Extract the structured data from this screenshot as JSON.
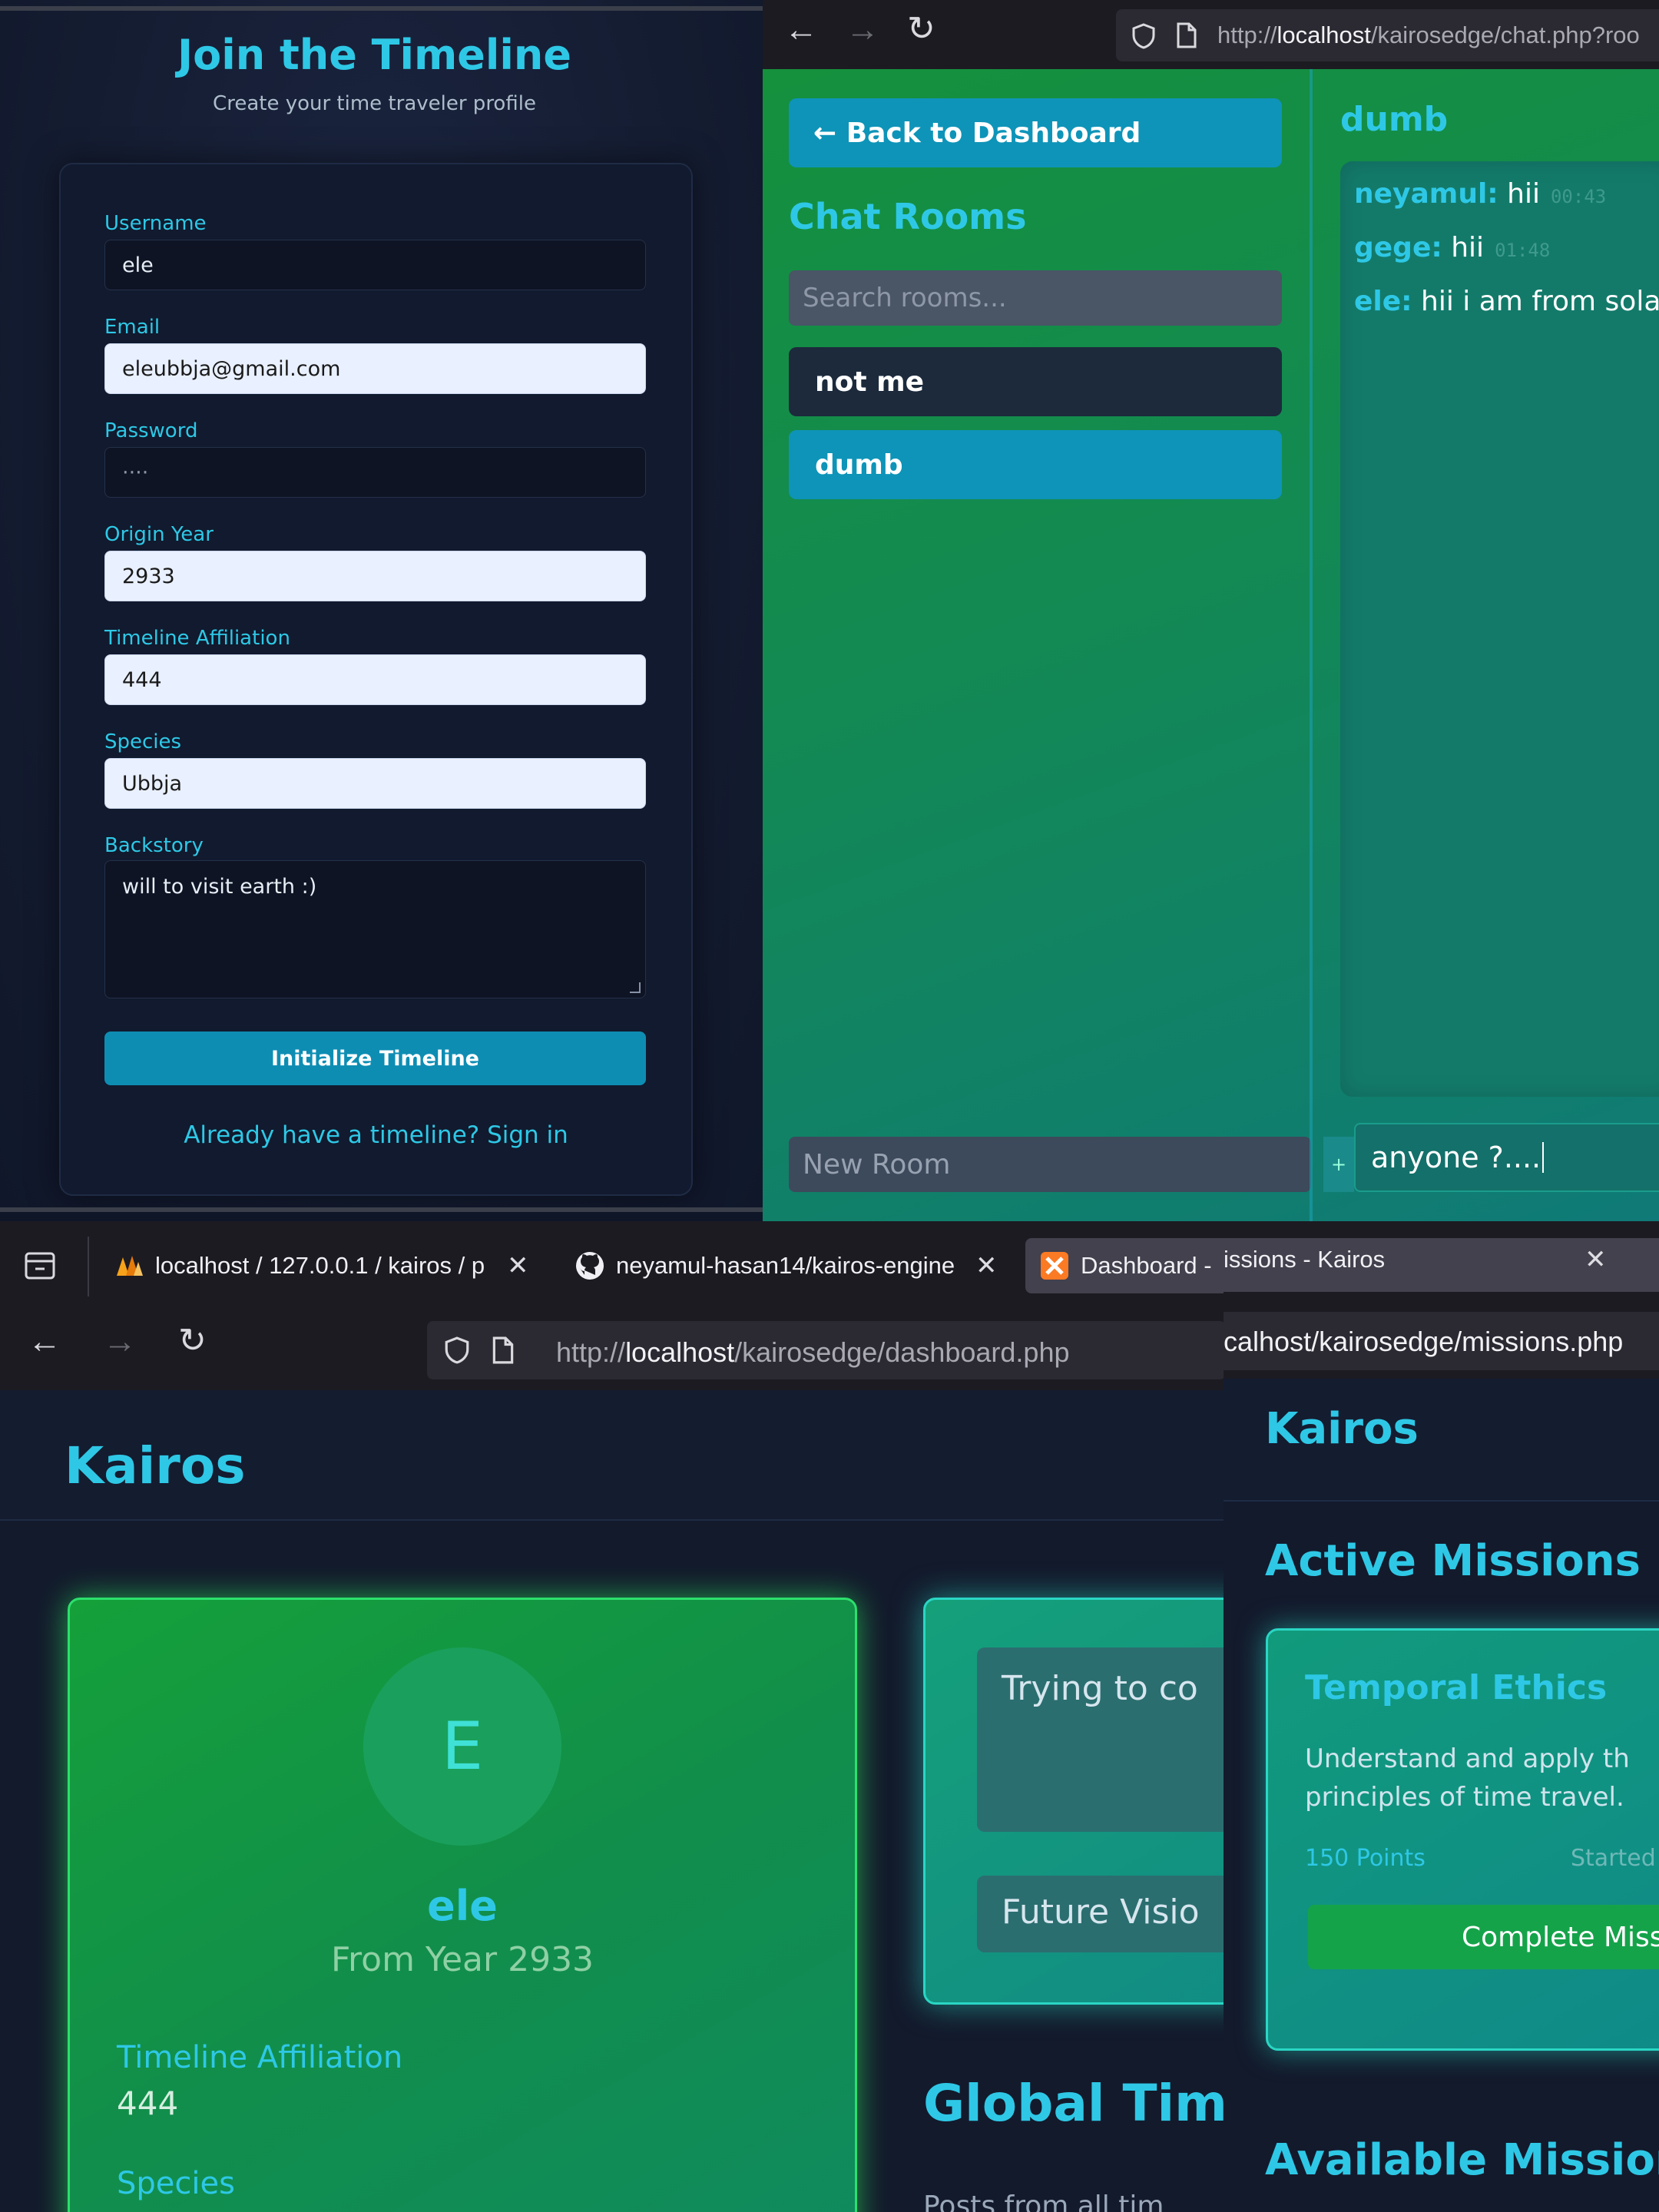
{
  "register": {
    "title": "Join the Timeline",
    "subtitle": "Create your time traveler profile",
    "fields": {
      "username": {
        "label": "Username",
        "value": "ele"
      },
      "email": {
        "label": "Email",
        "value": "eleubbja@gmail.com"
      },
      "password": {
        "label": "Password",
        "value": "····"
      },
      "origin_year": {
        "label": "Origin Year",
        "value": "2933"
      },
      "affiliation": {
        "label": "Timeline Affiliation",
        "value": "444"
      },
      "species": {
        "label": "Species",
        "value": "Ubbja"
      },
      "backstory": {
        "label": "Backstory",
        "value": "will to visit earth :)"
      }
    },
    "submit_label": "Initialize Timeline",
    "signin_link": "Already have a timeline? Sign in"
  },
  "chat": {
    "url_host": "localhost",
    "url_prefix": "http://",
    "url_path": "/kairosedge/chat.php?roo",
    "back_label": "← Back to Dashboard",
    "rooms_title": "Chat Rooms",
    "search_placeholder": "Search rooms...",
    "rooms": [
      {
        "name": "not me"
      },
      {
        "name": "dumb"
      }
    ],
    "new_room_placeholder": "New Room",
    "active_room": "dumb",
    "messages": [
      {
        "user": "neyamul:",
        "text": "hii",
        "time": "00:43"
      },
      {
        "user": "gege:",
        "text": "hii",
        "time": "01:48"
      },
      {
        "user": "ele:",
        "text": "hii i am from sola",
        "time": ""
      }
    ],
    "composer_value": "anyone ?....",
    "plus_label": "+"
  },
  "dashboard": {
    "tabs": [
      {
        "label": "localhost / 127.0.0.1 / kairos / p",
        "icon": "phpmyadmin-icon"
      },
      {
        "label": "neyamul-hasan14/kairos-engine",
        "icon": "github-icon"
      },
      {
        "label": "Dashboard -",
        "icon": "xampp-icon"
      }
    ],
    "url_prefix": "http://",
    "url_host": "localhost",
    "url_path": "/kairosedge/dashboard.php",
    "brand": "Kairos",
    "profile": {
      "initial": "E",
      "name": "ele",
      "from_year": "From Year 2933",
      "affiliation_label": "Timeline Affiliation",
      "affiliation_value": "444",
      "species_label": "Species"
    },
    "post_placeholder": "Trying to co",
    "future_vision": "Future Visio",
    "global_title": "Global Time",
    "global_sub": "Posts from all tim"
  },
  "missions": {
    "tab_label": "issions - Kairos",
    "url_text": "calhost/kairosedge/missions.php",
    "brand": "Kairos",
    "active_title": "Active Missions",
    "card": {
      "title": "Temporal Ethics",
      "desc1": "Understand and apply th",
      "desc2": "principles of time travel.",
      "points": "150 Points",
      "status": "Started",
      "button": "Complete Miss"
    },
    "available_title": "Available Missions"
  }
}
